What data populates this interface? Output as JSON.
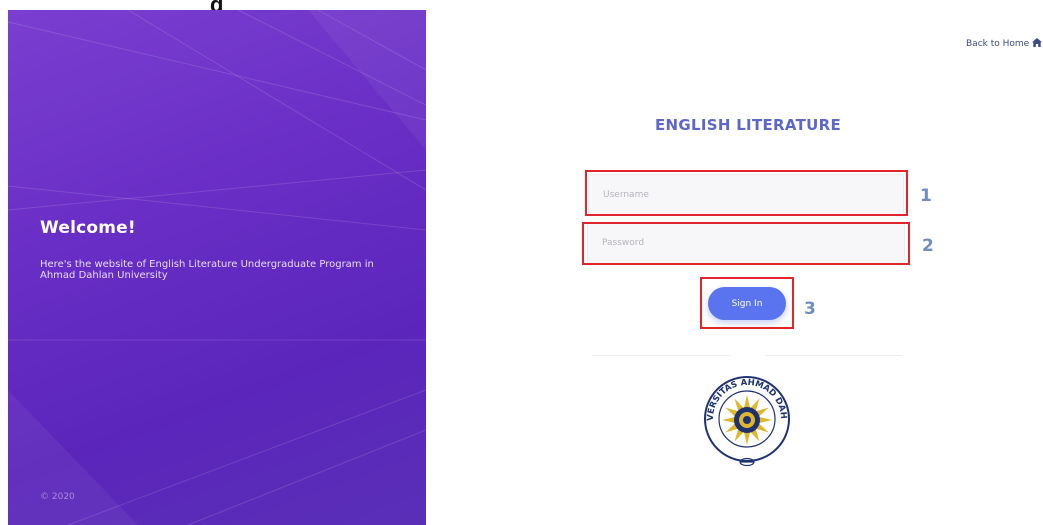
{
  "top_fragment": "g",
  "hero": {
    "title": "Welcome!",
    "description": "Here's the website of English Literature Undergraduate Program in Ahmad Dahlan University",
    "copyright": "© 2020"
  },
  "header": {
    "back_link": "Back to Home",
    "back_icon": "home-icon"
  },
  "login": {
    "heading": "ENGLISH LITERATURE",
    "username_placeholder": "Username",
    "password_placeholder": "Password",
    "signin_label": "Sign In"
  },
  "annotations": [
    "1",
    "2",
    "3"
  ],
  "logo": {
    "ring_text": "UNIVERSITAS AHMAD DAHLAN"
  },
  "colors": {
    "hero_gradient_start": "#7a3fd0",
    "hero_gradient_end": "#5a2fb7",
    "accent": "#5a73ee",
    "heading": "#5c67c8",
    "highlight_box": "#e0252c",
    "annotation_number": "#6f8dbf",
    "logo_navy": "#1f3270",
    "logo_gold": "#e0b62b"
  }
}
